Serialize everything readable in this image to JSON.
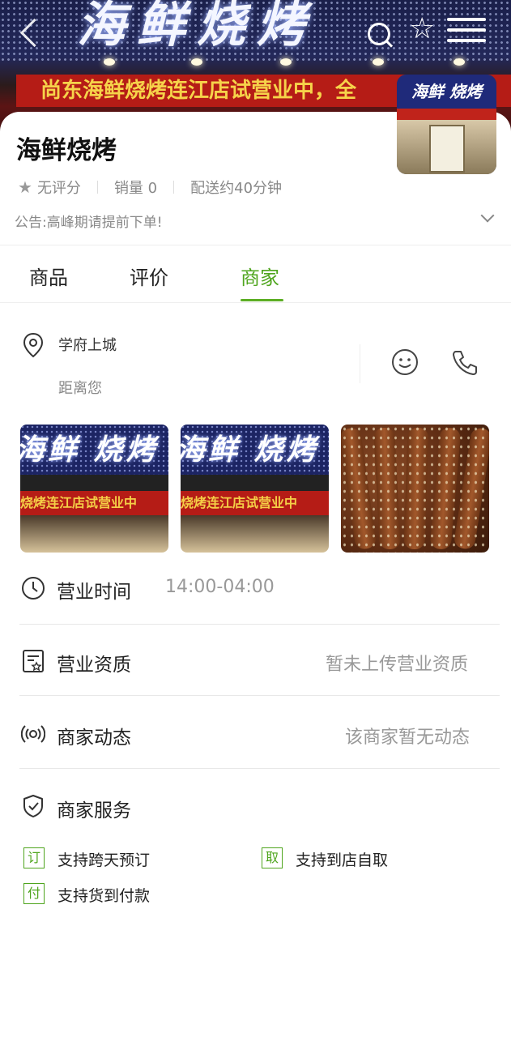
{
  "banner": {
    "sign_text": "海鲜烧烤",
    "red_band_text": "尚东海鲜烧烤连江店试营业中，全"
  },
  "thumb": {
    "sign_text": "海鲜 烧烤"
  },
  "shop": {
    "name": "海鲜烧烤",
    "rating": "无评分",
    "sales": "销量 0",
    "delivery": "配送约40分钟",
    "notice": "公告:高峰期请提前下单!"
  },
  "tabs": [
    {
      "label": "商品"
    },
    {
      "label": "评价"
    },
    {
      "label": "商家"
    }
  ],
  "active_tab": "商家",
  "merchant": {
    "address": "学府上城",
    "distance": "距离您"
  },
  "photos": {
    "store_sign": "海鲜 烧烤",
    "store_band": "烧烤连江店试营业中"
  },
  "rows": {
    "hours_label": "营业时间",
    "hours_value": "14:00-04:00",
    "license_label": "营业资质",
    "license_value": "暂未上传营业资质",
    "news_label": "商家动态",
    "news_value": "该商家暂无动态",
    "service_label": "商家服务"
  },
  "services": [
    {
      "badge": "订",
      "text": "支持跨天预订"
    },
    {
      "badge": "取",
      "text": "支持到店自取"
    },
    {
      "badge": "付",
      "text": "支持货到付款"
    }
  ],
  "colors": {
    "accent": "#5cae24",
    "text_muted": "#888888"
  },
  "icons": [
    "back-icon",
    "search-icon",
    "favorite-star-icon",
    "menu-icon",
    "location-pin-icon",
    "chat-icon",
    "phone-icon",
    "clock-icon",
    "license-icon",
    "broadcast-icon",
    "shield-check-icon",
    "chevron-down-icon"
  ]
}
